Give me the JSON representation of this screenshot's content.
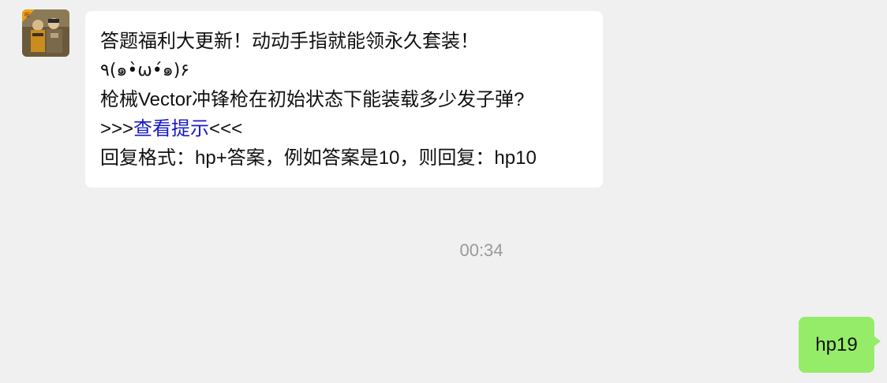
{
  "incoming": {
    "lines": [
      "答题福利大更新！动动手指就能领永久套装！",
      "٩(๑•̀ω•́๑)۶",
      "枪械Vector冲锋枪在初始状态下能装载多少发子弹?",
      "回复格式：hp+答案，例如答案是10，则回复：hp10"
    ],
    "hint_prefix": ">>>",
    "hint_link": "查看提示",
    "hint_suffix": "<<<"
  },
  "timestamp": "00:34",
  "outgoing": {
    "text": "hp19"
  },
  "colors": {
    "background": "#f0f0f0",
    "incoming_bubble": "#ffffff",
    "outgoing_bubble": "#95ec69",
    "link": "#1717c8",
    "timestamp": "#9a9a9a"
  },
  "icons": {
    "avatar": "game-avatar-icon"
  }
}
